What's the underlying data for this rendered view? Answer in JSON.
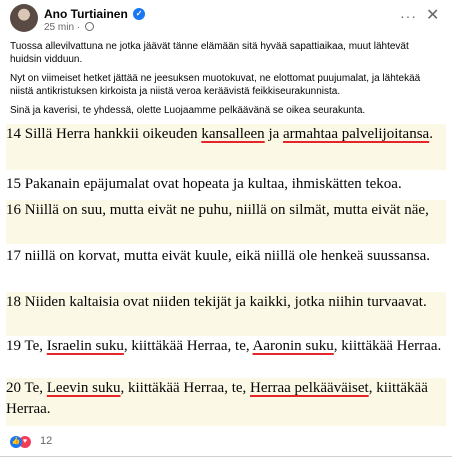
{
  "header": {
    "author": "Ano Turtiainen",
    "time": "25 min",
    "separator": "·"
  },
  "post": {
    "paragraphs": [
      "Tuossa allevilvattuna ne jotka jäävät tänne elämään sitä hyvää sapattiaikaa, muut lähtevät huidsin vidduun.",
      "Nyt on viimeiset hetket jättää ne jeesuksen muotokuvat, ne elottomat puujumalat, ja lähtekää niistä antikristuksen kirkoista ja niistä veroa keräävistä feikkiseurakunnista.",
      "Sinä ja kaverisi, te yhdessä, olette Luojaamme pelkäävänä se oikea seurakunta."
    ]
  },
  "verses": {
    "v14": {
      "a": "14 Sillä Herra hankkii oikeuden ",
      "u1": "kansalleen",
      "b": " ja ",
      "u2": "armahtaa palvelijoitansa",
      "c": "."
    },
    "v15": {
      "text": "15 Pakanain epäjumalat ovat hopeata ja kultaa, ihmiskätten tekoa."
    },
    "v16": {
      "text": "16 Niillä on suu, mutta eivät ne puhu, niillä on silmät, mutta eivät näe,"
    },
    "v17": {
      "text": "17 niillä on korvat, mutta eivät kuule, eikä niillä ole henkeä suussansa."
    },
    "v18": {
      "text": "18 Niiden kaltaisia ovat niiden tekijät ja kaikki, jotka niihin turvaavat."
    },
    "v19": {
      "a": "19 Te, ",
      "u1": "Israelin suku",
      "b": ", kiittäkää Herraa, te, ",
      "u2": "Aaronin suku",
      "c": ", kiittäkää Herraa."
    },
    "v20": {
      "a": "20 Te, ",
      "u1": "Leevin suku",
      "b": ", kiittäkää Herraa, te, ",
      "u2": "Herraa pelkääväiset",
      "c": ", kiittäkää Herraa."
    }
  },
  "reactions": {
    "count": "12",
    "icons": [
      "like-icon",
      "love-icon"
    ],
    "like_glyph": "👍",
    "love_glyph": "♥"
  },
  "colors": {
    "highlight": "#fbf8e6",
    "underline": "#e4252a",
    "facebook_blue": "#1877f2"
  }
}
